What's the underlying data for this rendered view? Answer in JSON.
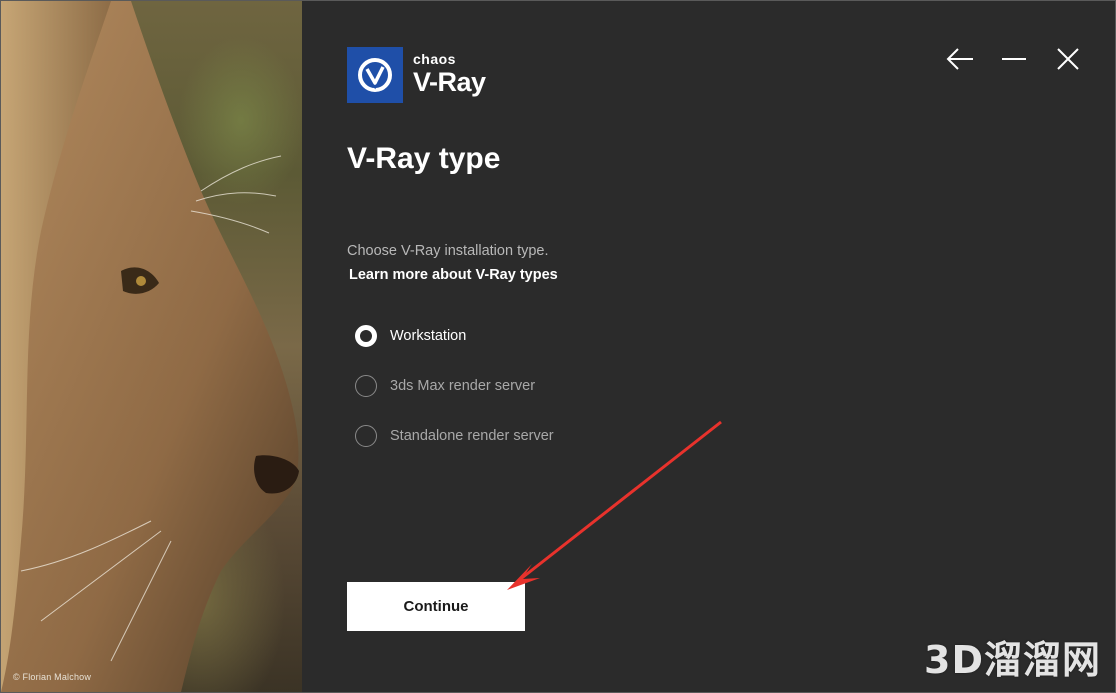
{
  "photo": {
    "credit": "© Florian Malchow"
  },
  "logo": {
    "company": "chaos",
    "product": "V-Ray"
  },
  "window_controls": {
    "icons": [
      "back-arrow-icon",
      "minimize-icon",
      "close-icon"
    ]
  },
  "page": {
    "title": "V-Ray type",
    "instruction": "Choose V-Ray installation type.",
    "learn_more_link": "Learn more about V-Ray types"
  },
  "options": [
    {
      "label": "Workstation",
      "selected": true
    },
    {
      "label": "3ds Max render server",
      "selected": false
    },
    {
      "label": "Standalone render server",
      "selected": false
    }
  ],
  "continue_button": {
    "label": "Continue"
  },
  "watermark": "3D溜溜网",
  "colors": {
    "background": "#2b2b2b",
    "logo_blue": "#1f4fa8",
    "annotation_arrow": "#e8322c"
  }
}
